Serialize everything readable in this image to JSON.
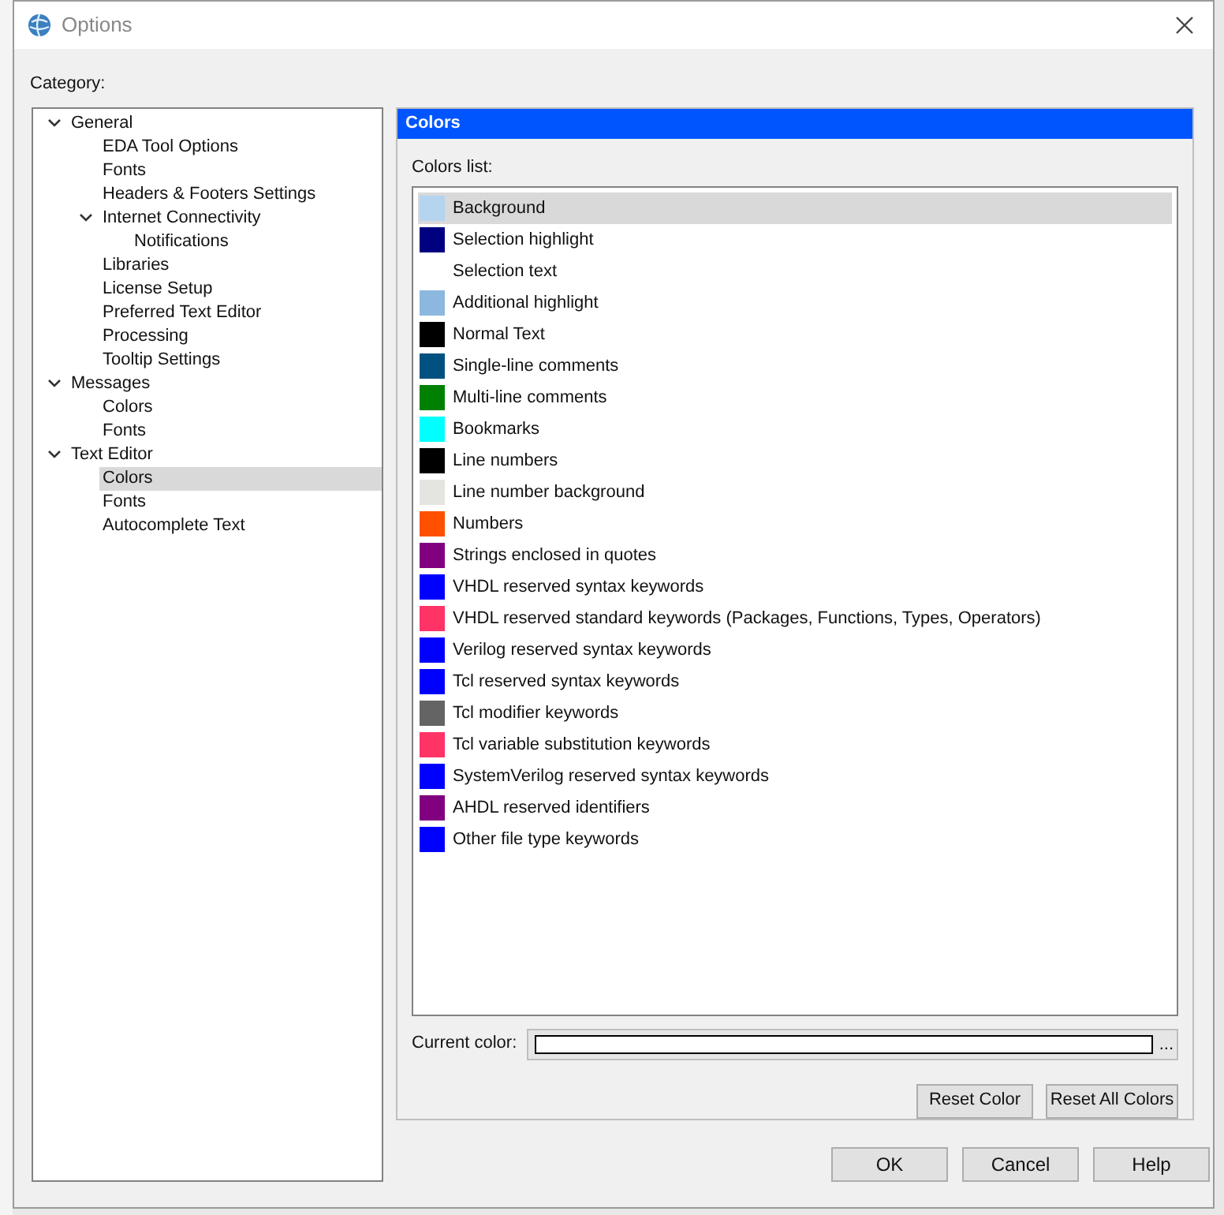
{
  "window": {
    "title": "Options"
  },
  "category_label": "Category:",
  "tree": [
    {
      "label": "General",
      "expanded": true,
      "selected": false,
      "children": [
        {
          "label": "EDA Tool Options",
          "selected": false
        },
        {
          "label": "Fonts",
          "selected": false
        },
        {
          "label": "Headers & Footers Settings",
          "selected": false
        },
        {
          "label": "Internet Connectivity",
          "expanded": true,
          "selected": false,
          "children": [
            {
              "label": "Notifications",
              "selected": false
            }
          ]
        },
        {
          "label": "Libraries",
          "selected": false
        },
        {
          "label": "License Setup",
          "selected": false
        },
        {
          "label": "Preferred Text Editor",
          "selected": false
        },
        {
          "label": "Processing",
          "selected": false
        },
        {
          "label": "Tooltip Settings",
          "selected": false
        }
      ]
    },
    {
      "label": "Messages",
      "expanded": true,
      "selected": false,
      "children": [
        {
          "label": "Colors",
          "selected": false
        },
        {
          "label": "Fonts",
          "selected": false
        }
      ]
    },
    {
      "label": "Text Editor",
      "expanded": true,
      "selected": false,
      "children": [
        {
          "label": "Colors",
          "selected": true
        },
        {
          "label": "Fonts",
          "selected": false
        },
        {
          "label": "Autocomplete Text",
          "selected": false
        }
      ]
    }
  ],
  "panel": {
    "title": "Colors",
    "list_label": "Colors list:",
    "colors": [
      {
        "name": "Background",
        "color": "#b4d4f0",
        "selected": true
      },
      {
        "name": "Selection highlight",
        "color": "#000080",
        "selected": false
      },
      {
        "name": "Selection text",
        "selected": false
      },
      {
        "name": "Additional highlight",
        "color": "#8cb8e0",
        "selected": false
      },
      {
        "name": "Normal Text",
        "color": "#000000",
        "selected": false
      },
      {
        "name": "Single-line comments",
        "color": "#005080",
        "selected": false
      },
      {
        "name": "Multi-line comments",
        "color": "#008000",
        "selected": false
      },
      {
        "name": "Bookmarks",
        "color": "#00ffff",
        "selected": false
      },
      {
        "name": "Line numbers",
        "color": "#000000",
        "selected": false
      },
      {
        "name": "Line number background",
        "color": "#e4e4e0",
        "selected": false
      },
      {
        "name": "Numbers",
        "color": "#ff5000",
        "selected": false
      },
      {
        "name": "Strings enclosed in quotes",
        "color": "#800080",
        "selected": false
      },
      {
        "name": "VHDL reserved syntax keywords",
        "color": "#0000ff",
        "selected": false
      },
      {
        "name": "VHDL reserved standard keywords (Packages, Functions, Types, Operators)",
        "color": "#ff3366",
        "selected": false
      },
      {
        "name": "Verilog reserved syntax keywords",
        "color": "#0000ff",
        "selected": false
      },
      {
        "name": "Tcl reserved syntax keywords",
        "color": "#0000ff",
        "selected": false
      },
      {
        "name": "Tcl modifier keywords",
        "color": "#646464",
        "selected": false
      },
      {
        "name": "Tcl variable substitution keywords",
        "color": "#ff3366",
        "selected": false
      },
      {
        "name": "SystemVerilog reserved syntax keywords",
        "color": "#0000ff",
        "selected": false
      },
      {
        "name": "AHDL reserved identifiers",
        "color": "#800080",
        "selected": false
      },
      {
        "name": "Other file type keywords",
        "color": "#0000ff",
        "selected": false
      }
    ],
    "current_color_label": "Current color:",
    "browse": "...",
    "buttons": [
      "Reset Color",
      "Reset All Colors"
    ]
  },
  "buttons": [
    "OK",
    "Cancel",
    "Help"
  ]
}
